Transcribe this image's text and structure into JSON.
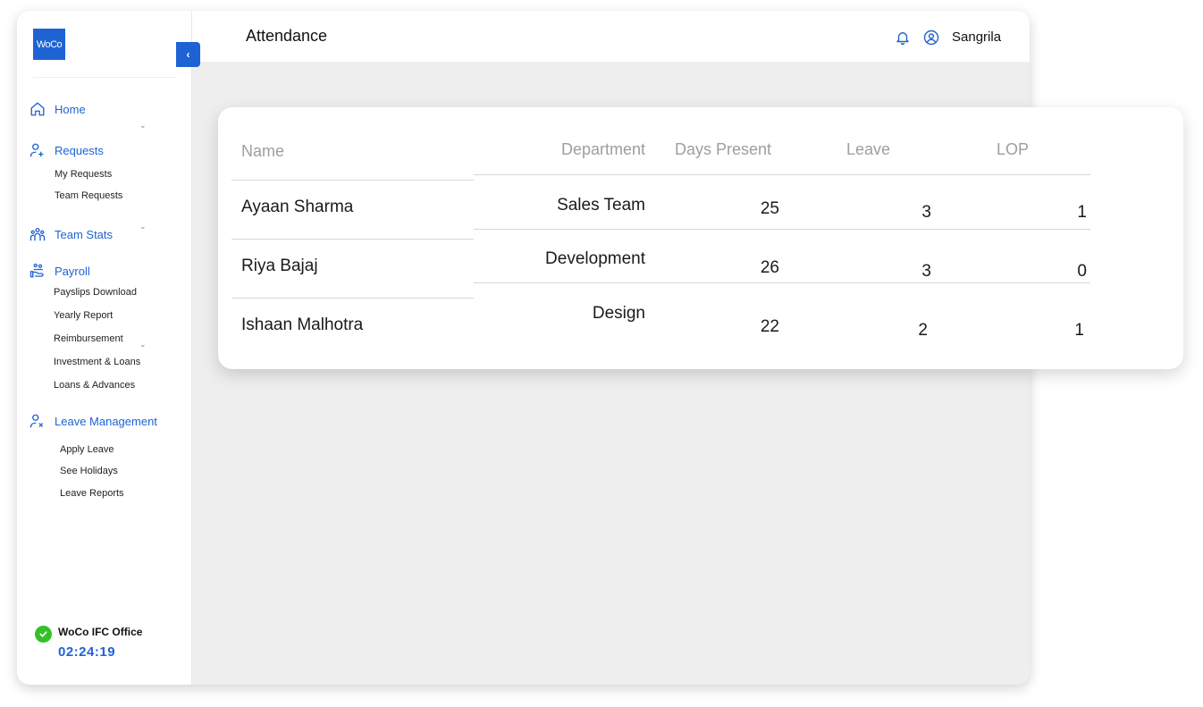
{
  "app": {
    "logo_text": "WoCo"
  },
  "header": {
    "title": "Attendance",
    "user_name": "Sangrila"
  },
  "sidebar": {
    "home": "Home",
    "requests": {
      "label": "Requests",
      "items": [
        "My Requests",
        "Team Requests"
      ]
    },
    "team_stats": "Team Stats",
    "payroll": {
      "label": "Payroll",
      "items": [
        "Payslips Download",
        "Yearly Report",
        "Reimbursement",
        "Investment & Loans",
        "Loans & Advances"
      ]
    },
    "leave": {
      "label": "Leave Management",
      "items": [
        "Apply Leave",
        "See Holidays",
        "Leave Reports"
      ]
    },
    "office": {
      "name": "WoCo IFC Office",
      "time": "02:24:19"
    }
  },
  "table": {
    "columns": [
      "Name",
      "Department",
      "Days Present",
      "Leave",
      "LOP"
    ],
    "rows": [
      {
        "name": "Ayaan Sharma",
        "department": "Sales Team",
        "days_present": "25",
        "leave": "3",
        "lop": "1"
      },
      {
        "name": "Riya Bajaj",
        "department": "Development",
        "days_present": "26",
        "leave": "3",
        "lop": "0"
      },
      {
        "name": "Ishaan Malhotra",
        "department": "Design",
        "days_present": "22",
        "leave": "2",
        "lop": "1"
      }
    ]
  },
  "colors": {
    "accent": "#1e63d4",
    "success": "#35c02a",
    "background": "#eeeeee"
  },
  "icons": [
    "home-icon",
    "user-plus-icon",
    "team-icon",
    "payroll-icon",
    "user-x-icon",
    "check-icon",
    "bell-icon",
    "user-circle-icon",
    "chevron-left-icon",
    "chevron-down-icon"
  ]
}
